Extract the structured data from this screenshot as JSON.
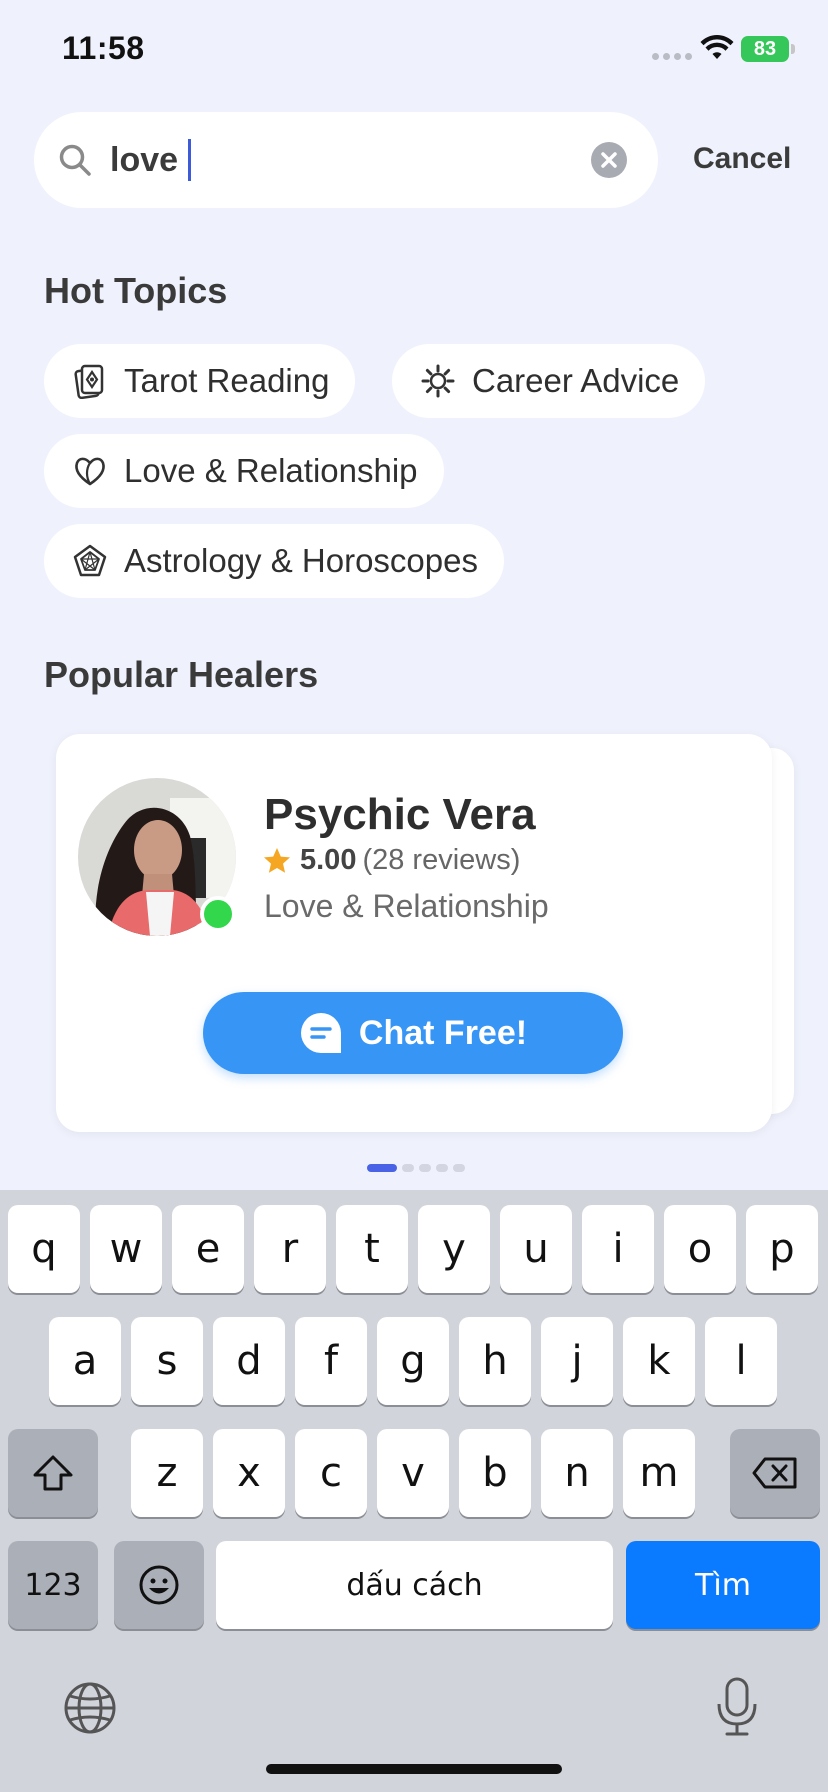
{
  "status_bar": {
    "time": "11:58",
    "battery": "83"
  },
  "search": {
    "value": "love",
    "cancel_label": "Cancel"
  },
  "hot_topics": {
    "title": "Hot Topics",
    "items": [
      {
        "label": "Tarot Reading",
        "icon": "tarot-card-icon"
      },
      {
        "label": "Career Advice",
        "icon": "gear-sun-icon"
      },
      {
        "label": "Love & Relationship",
        "icon": "heart-icon"
      },
      {
        "label": "Astrology & Horoscopes",
        "icon": "astrology-chart-icon"
      }
    ]
  },
  "popular_healers": {
    "title": "Popular Healers",
    "healer": {
      "name": "Psychic Vera",
      "rating": "5.00",
      "reviews": "(28 reviews)",
      "topic": "Love & Relationship",
      "chat_label": "Chat Free!",
      "online": true
    },
    "pager": {
      "count": 5,
      "active": 0
    }
  },
  "keyboard": {
    "row1": [
      "q",
      "w",
      "e",
      "r",
      "t",
      "y",
      "u",
      "i",
      "o",
      "p"
    ],
    "row2": [
      "a",
      "s",
      "d",
      "f",
      "g",
      "h",
      "j",
      "k",
      "l"
    ],
    "row3": [
      "z",
      "x",
      "c",
      "v",
      "b",
      "n",
      "m"
    ],
    "numbers_label": "123",
    "space_label": "dấu cách",
    "search_label": "Tìm"
  },
  "colors": {
    "accent": "#3795f5",
    "background": "#eff2fc",
    "online": "#32d74b",
    "keyboard_action": "#0a7aff"
  }
}
